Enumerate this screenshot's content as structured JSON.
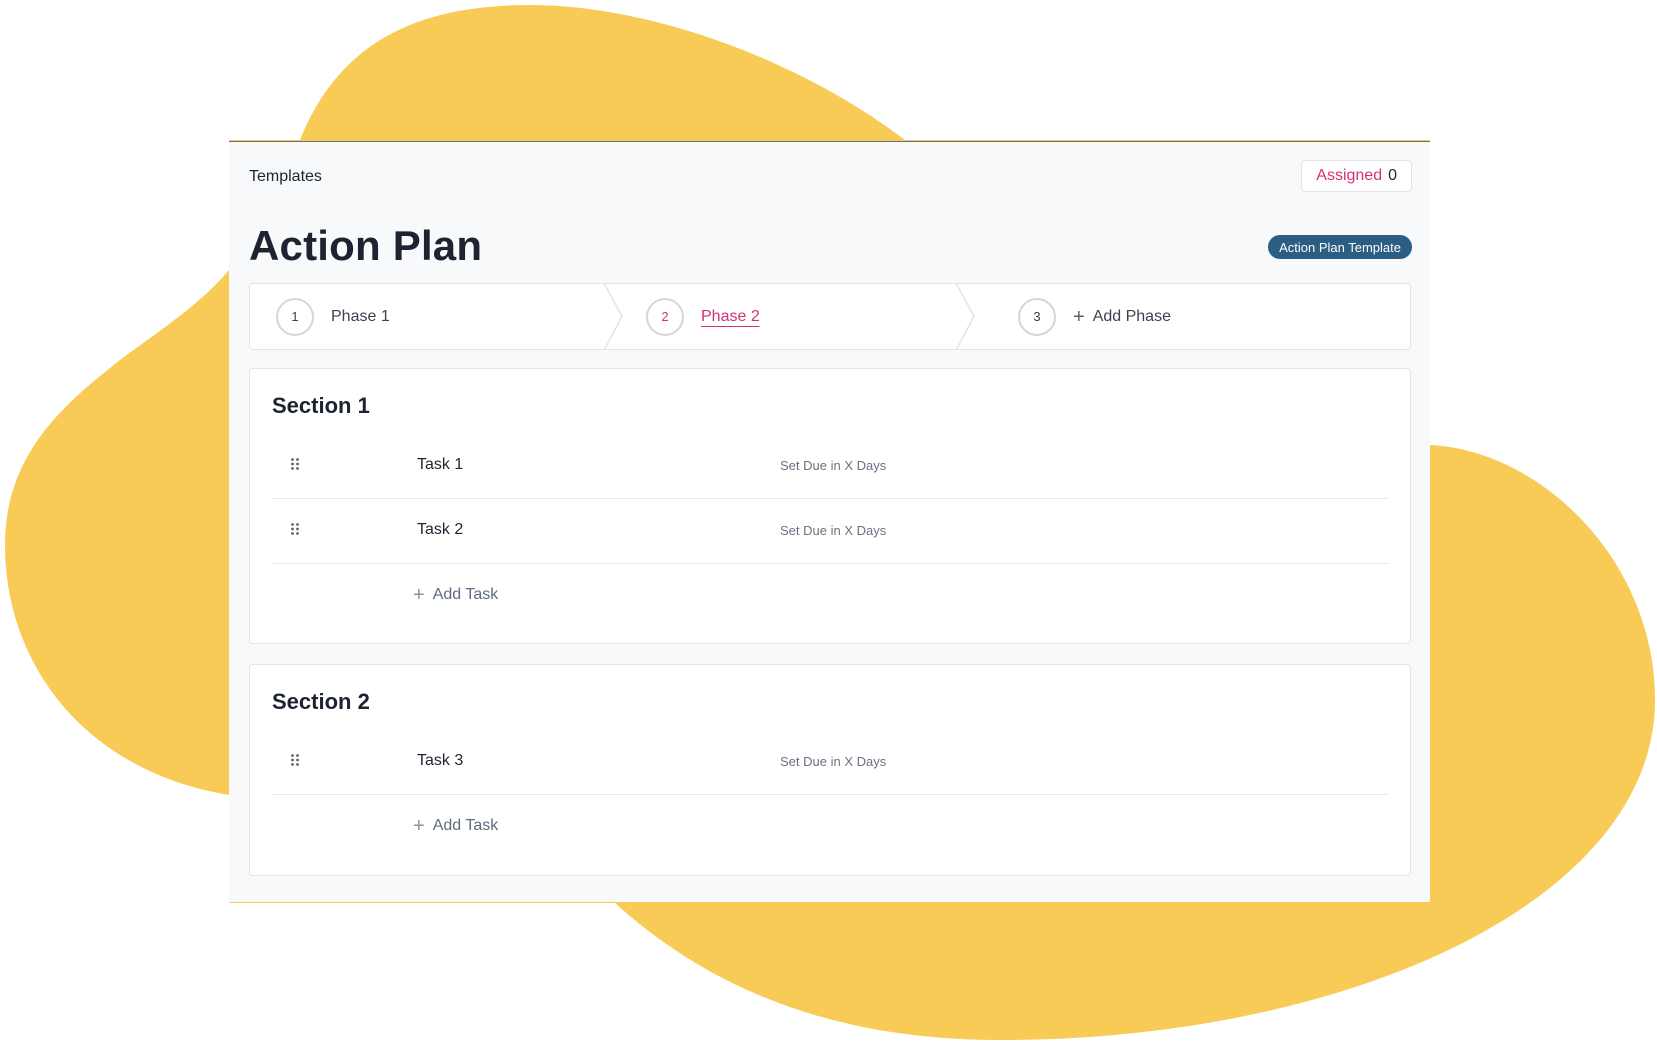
{
  "header": {
    "breadcrumb": "Templates",
    "assigned_label": "Assigned",
    "assigned_count": "0",
    "title": "Action Plan",
    "badge": "Action Plan Template"
  },
  "phases": {
    "items": [
      {
        "number": "1",
        "label": "Phase 1",
        "active": false
      },
      {
        "number": "2",
        "label": "Phase 2",
        "active": true
      },
      {
        "number": "3",
        "label": "Add Phase",
        "is_add": true
      }
    ]
  },
  "sections": [
    {
      "title": "Section 1",
      "tasks": [
        {
          "name": "Task 1",
          "due": "Set Due in X Days"
        },
        {
          "name": "Task 2",
          "due": "Set Due in X Days"
        }
      ],
      "add_label": "Add Task"
    },
    {
      "title": "Section 2",
      "tasks": [
        {
          "name": "Task 3",
          "due": "Set Due in X Days"
        }
      ],
      "add_label": "Add Task"
    }
  ],
  "colors": {
    "accent": "#d6307a",
    "badge": "#2c5d83",
    "blob": "#f7cb55",
    "panel_bg": "#f8f9fb"
  },
  "icons": {
    "drag": "drag-handle-icon",
    "plus": "plus-icon"
  }
}
